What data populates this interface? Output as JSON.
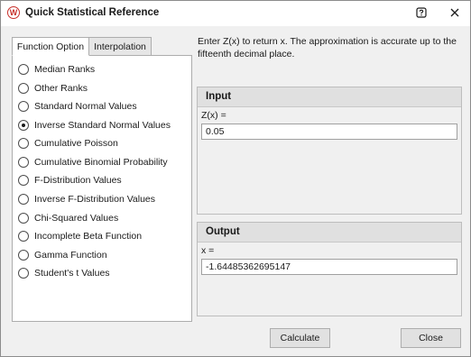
{
  "window": {
    "title": "Quick Statistical Reference",
    "app_icon_letter": "W"
  },
  "tabs": [
    {
      "label": "Function Option",
      "active": true
    },
    {
      "label": "Interpolation",
      "active": false
    }
  ],
  "function_options": [
    {
      "label": "Median Ranks",
      "checked": false
    },
    {
      "label": "Other Ranks",
      "checked": false
    },
    {
      "label": "Standard Normal Values",
      "checked": false
    },
    {
      "label": "Inverse Standard Normal Values",
      "checked": true
    },
    {
      "label": "Cumulative Poisson",
      "checked": false
    },
    {
      "label": "Cumulative Binomial Probability",
      "checked": false
    },
    {
      "label": "F-Distribution Values",
      "checked": false
    },
    {
      "label": "Inverse F-Distribution Values",
      "checked": false
    },
    {
      "label": "Chi-Squared Values",
      "checked": false
    },
    {
      "label": "Incomplete Beta Function",
      "checked": false
    },
    {
      "label": "Gamma Function",
      "checked": false
    },
    {
      "label": "Student's t Values",
      "checked": false
    }
  ],
  "description": "Enter Z(x) to return x. The approximation is accurate up to the fifteenth decimal place.",
  "input": {
    "header": "Input",
    "label": "Z(x) =",
    "value": "0.05"
  },
  "output": {
    "header": "Output",
    "label": "x =",
    "value": "-1.64485362695147"
  },
  "buttons": {
    "calculate": "Calculate",
    "close": "Close"
  },
  "colors": {
    "brand": "#c8302b",
    "dialog_bg": "#f0f0f0",
    "group_header_bg": "#e0e0e0"
  }
}
